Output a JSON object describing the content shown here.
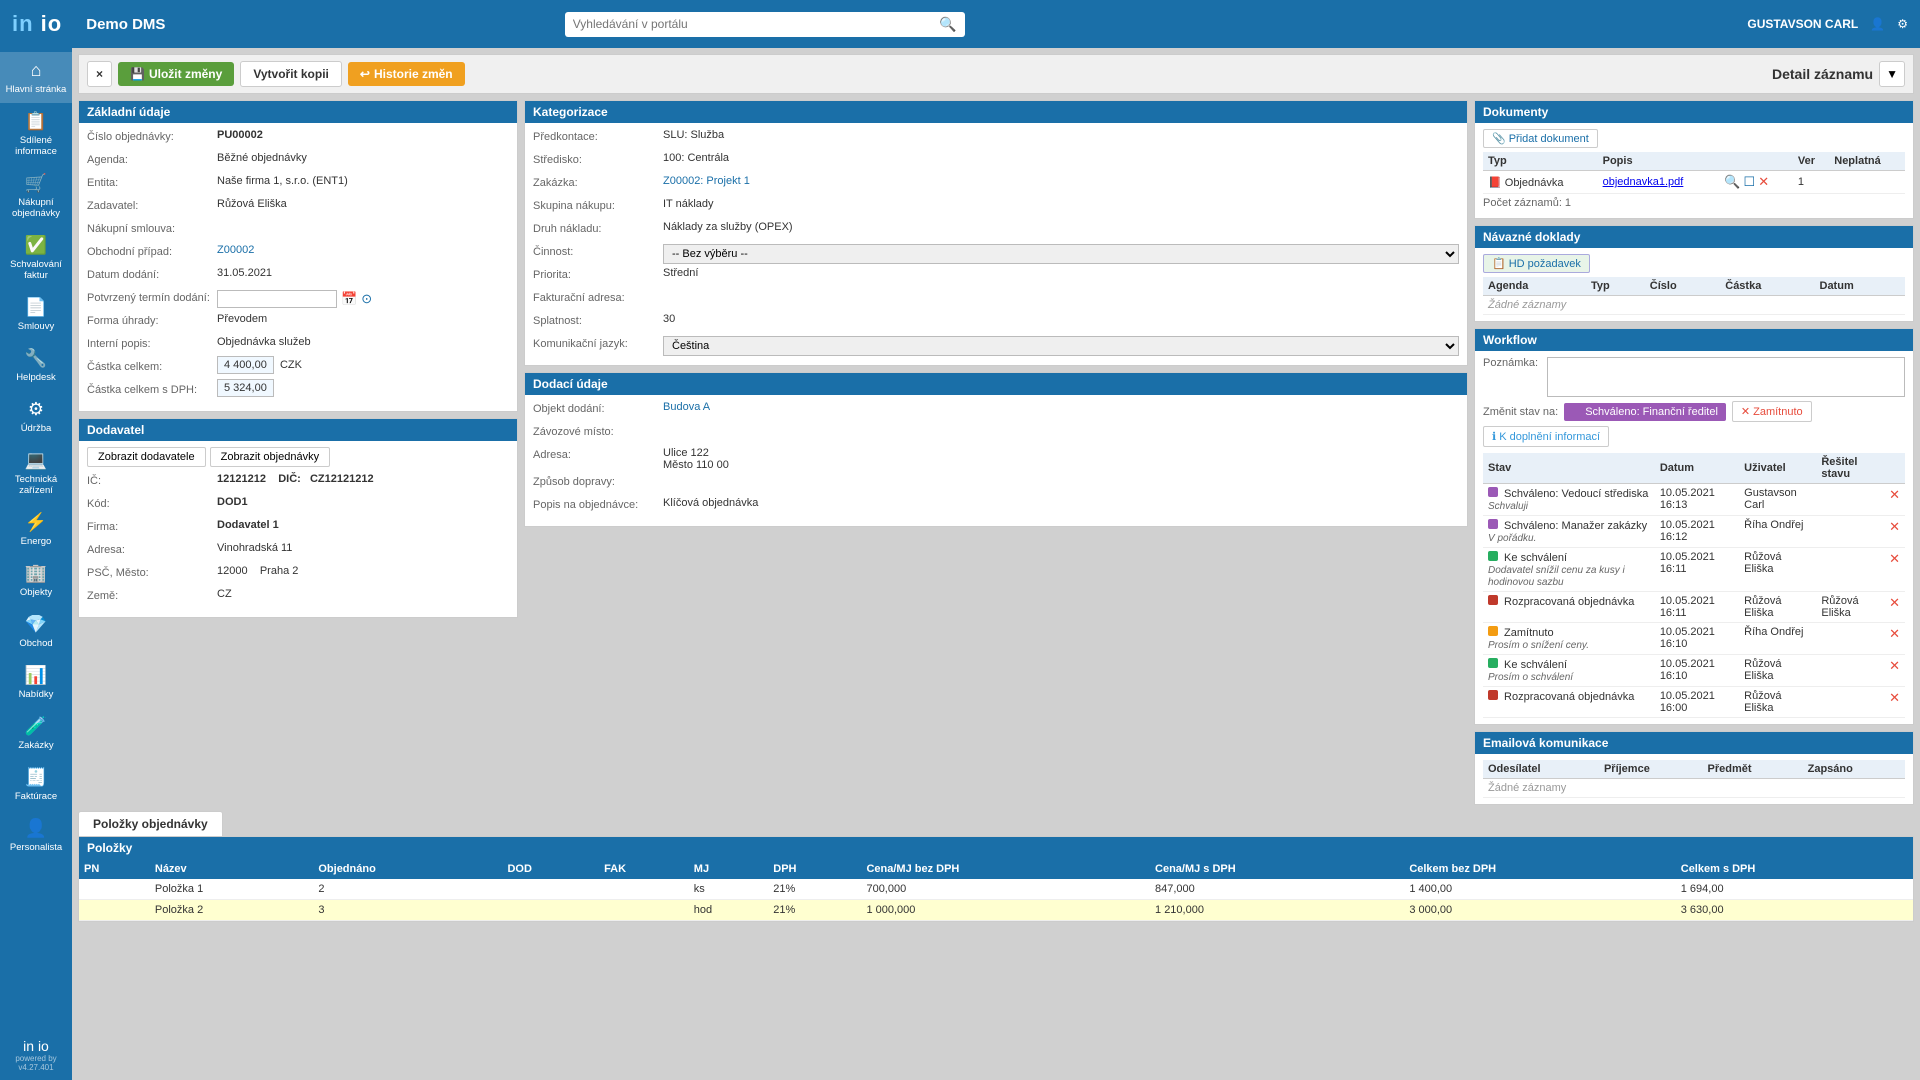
{
  "app": {
    "logo": "in io",
    "title": "Demo DMS",
    "search_placeholder": "Vyhledávání v portálu",
    "user": "GUSTAVSON CARL"
  },
  "sidebar": {
    "items": [
      {
        "label": "Hlavní stránka",
        "icon": "⌂"
      },
      {
        "label": "Sdílené informace",
        "icon": "📋"
      },
      {
        "label": "Nákupní objednávky",
        "icon": "🛒"
      },
      {
        "label": "Schvalování faktur",
        "icon": "✅"
      },
      {
        "label": "Smlouvy",
        "icon": "📄"
      },
      {
        "label": "Helpdesk",
        "icon": "🔧"
      },
      {
        "label": "Údržba",
        "icon": "⚙"
      },
      {
        "label": "Technická zařízení",
        "icon": "💻"
      },
      {
        "label": "Energo",
        "icon": "⚡"
      },
      {
        "label": "Objekty",
        "icon": "🏢"
      },
      {
        "label": "Obchod",
        "icon": "💎"
      },
      {
        "label": "Nabídky",
        "icon": "📊"
      },
      {
        "label": "Zakázky",
        "icon": "🧪"
      },
      {
        "label": "Faktúrace",
        "icon": "🧾"
      },
      {
        "label": "Personalista",
        "icon": "👤"
      }
    ],
    "powered": "powered by",
    "version": "v4.27.401"
  },
  "toolbar": {
    "close_label": "×",
    "save_label": "Uložit změny",
    "copy_label": "Vytvořit kopii",
    "history_label": "Historie změn",
    "detail_label": "Detail záznamu"
  },
  "basic_info": {
    "header": "Základní údaje",
    "fields": {
      "order_number_label": "Číslo objednávky:",
      "order_number": "PU00002",
      "agenda_label": "Agenda:",
      "agenda": "Běžné objednávky",
      "entity_label": "Entita:",
      "entity": "Naše firma 1, s.r.o. (ENT1)",
      "requestor_label": "Zadavatel:",
      "requestor": "Růžová Eliška",
      "purchase_contract_label": "Nákupní smlouva:",
      "purchase_contract": "",
      "business_case_label": "Obchodní případ:",
      "business_case": "Z00002",
      "delivery_date_label": "Datum dodání:",
      "delivery_date": "31.05.2021",
      "confirmed_delivery_label": "Potvrzený termín dodání:",
      "confirmed_delivery": "",
      "payment_form_label": "Forma úhrady:",
      "payment_form": "Převodem",
      "internal_desc_label": "Interní popis:",
      "internal_desc": "Objednávka služeb",
      "total_label": "Částka celkem:",
      "total": "4 400,00",
      "total_currency": "CZK",
      "total_vat_label": "Částka celkem s DPH:",
      "total_vat": "5 324,00"
    }
  },
  "supplier": {
    "header": "Dodavatel",
    "btn_show": "Zobrazit dodavatele",
    "btn_order": "Zobrazit objednávky",
    "fields": {
      "ico_label": "IČ:",
      "ico": "12121212",
      "dic_label": "DIČ:",
      "dic": "CZ12121212",
      "code_label": "Kód:",
      "code": "DOD1",
      "company_label": "Firma:",
      "company": "Dodavatel 1",
      "address_label": "Adresa:",
      "address": "Vinohradská 11",
      "psc_label": "PSČ, Město:",
      "psc": "12000",
      "city": "Praha 2",
      "country_label": "Země:",
      "country": "CZ"
    }
  },
  "categorization": {
    "header": "Kategorizace",
    "fields": {
      "precontact_label": "Předkontace:",
      "precontact": "SLU: Služba",
      "center_label": "Středisko:",
      "center": "100: Centrála",
      "order_label": "Zakázka:",
      "order": "Z00002: Projekt 1",
      "purchase_group_label": "Skupina nákupu:",
      "purchase_group": "IT náklady",
      "cost_type_label": "Druh nákladu:",
      "cost_type": "Náklady za služby (OPEX)",
      "activity_label": "Činnost:",
      "activity": "-- Bez výběru --",
      "priority_label": "Priorita:",
      "priority": "Střední",
      "invoice_address_label": "Fakturační adresa:",
      "invoice_address": "",
      "due_days_label": "Splatnost:",
      "due_days": "30",
      "language_label": "Komunikační jazyk:",
      "language": "Čeština"
    }
  },
  "delivery": {
    "header": "Dodací údaje",
    "fields": {
      "delivery_object_label": "Objekt dodání:",
      "delivery_object": "Budova A",
      "loading_place_label": "Závozové místo:",
      "loading_place": "",
      "address_label": "Adresa:",
      "address": "Ulice 122\nMěsto 110 00",
      "transport_label": "Způsob dopravy:",
      "transport": "",
      "note_label": "Popis na objednávce:",
      "note": "Klíčová objednávka"
    }
  },
  "documents": {
    "header": "Dokumenty",
    "add_btn": "Přidat dokument",
    "columns": [
      "Typ",
      "Popis",
      "",
      "Ver",
      "Neplatná"
    ],
    "rows": [
      {
        "type": "Objednávka",
        "popis": "objednavka1.pdf",
        "ver": "1",
        "neplatna": false
      }
    ],
    "count": "Počet záznamů: 1"
  },
  "related_docs": {
    "header": "Návazné doklady",
    "add_btn": "HD požadavek",
    "columns": [
      "Agenda",
      "Typ",
      "Číslo",
      "Částka",
      "Datum"
    ],
    "empty": "Žádné záznamy"
  },
  "workflow": {
    "header": "Workflow",
    "note_label": "Poznámka:",
    "change_state_label": "Změnit stav na:",
    "btn_approve": "Schváleno: Finanční ředitel",
    "btn_reject": "Zamítnuto",
    "btn_info": "K doplnění informací",
    "columns": [
      "Stav",
      "Datum",
      "Uživatel",
      "Řešitel stavu"
    ],
    "rows": [
      {
        "dot": "purple",
        "state": "Schváleno: Vedoucí střediska",
        "date": "10.05.2021 16:13",
        "user": "Gustavson Carl",
        "resolver": "",
        "note": "Schvaluji"
      },
      {
        "dot": "purple",
        "state": "Schváleno: Manažer zakázky",
        "date": "10.05.2021 16:12",
        "user": "Říha Ondřej",
        "resolver": "",
        "note": "V pořádku."
      },
      {
        "dot": "green",
        "state": "Ke schválení",
        "date": "10.05.2021 16:11",
        "user": "Růžová Eliška",
        "resolver": "",
        "note": "Dodavatel snížil cenu za kusy i hodinovou sazbu"
      },
      {
        "dot": "red",
        "state": "Rozpracovaná objednávka",
        "date": "10.05.2021 16:11",
        "user": "Růžová Eliška",
        "resolver": "Růžová Eliška",
        "note": ""
      },
      {
        "dot": "yellow",
        "state": "Zamítnuto",
        "date": "10.05.2021 16:10",
        "user": "Říha Ondřej",
        "resolver": "",
        "note": "Prosím o snížení ceny."
      },
      {
        "dot": "green",
        "state": "Ke schválení",
        "date": "10.05.2021 16:10",
        "user": "Růžová Eliška",
        "resolver": "",
        "note": "Prosím o schválení"
      },
      {
        "dot": "red",
        "state": "Rozpracovaná objednávka",
        "date": "10.05.2021 16:00",
        "user": "Růžová Eliška",
        "resolver": "",
        "note": ""
      }
    ]
  },
  "email": {
    "header": "Emailová komunikace",
    "columns": [
      "Odesílatel",
      "Příjemce",
      "Předmět",
      "Zapsáno"
    ],
    "empty": "Žádné záznamy"
  },
  "tabs": [
    {
      "label": "Položky objednávky",
      "active": true
    }
  ],
  "items": {
    "header": "Položky",
    "columns": [
      "PN",
      "Název",
      "Objednáno",
      "DOD",
      "FAK",
      "MJ",
      "DPH",
      "Cena/MJ bez DPH",
      "Cena/MJ s DPH",
      "Celkem bez DPH",
      "Celkem s DPH"
    ],
    "rows": [
      {
        "pn": "",
        "name": "Položka 1",
        "objednano": "2",
        "dod": "",
        "fak": "",
        "mj": "ks",
        "dph": "21%",
        "cena_bez": "700,000",
        "cena_s": "847,000",
        "celkem_bez": "1 400,00",
        "celkem_s": "1 694,00"
      },
      {
        "pn": "",
        "name": "Položka 2",
        "objednano": "3",
        "dod": "",
        "fak": "",
        "mj": "hod",
        "dph": "21%",
        "cena_bez": "1 000,000",
        "cena_s": "1 210,000",
        "celkem_bez": "3 000,00",
        "celkem_s": "3 630,00"
      }
    ]
  }
}
